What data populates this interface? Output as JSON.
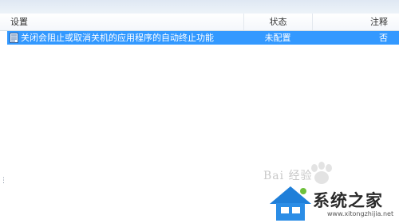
{
  "list": {
    "columns": {
      "setting": "设置",
      "status": "状态",
      "note": "注释"
    },
    "rows": [
      {
        "icon": "policy-document-icon",
        "name": "关闭会阻止或取消关机的应用程序的自动终止功能",
        "status": "未配置",
        "note": "否",
        "selected": true
      }
    ]
  },
  "watermark": {
    "text": "Bai 经验",
    "logo_name": "系统之家",
    "logo_url": "www.xitongzhijia.net"
  },
  "colors": {
    "selection": "#3399ff",
    "header_bg": "#f4f7fb",
    "top_strip": "#dfe8f3"
  }
}
